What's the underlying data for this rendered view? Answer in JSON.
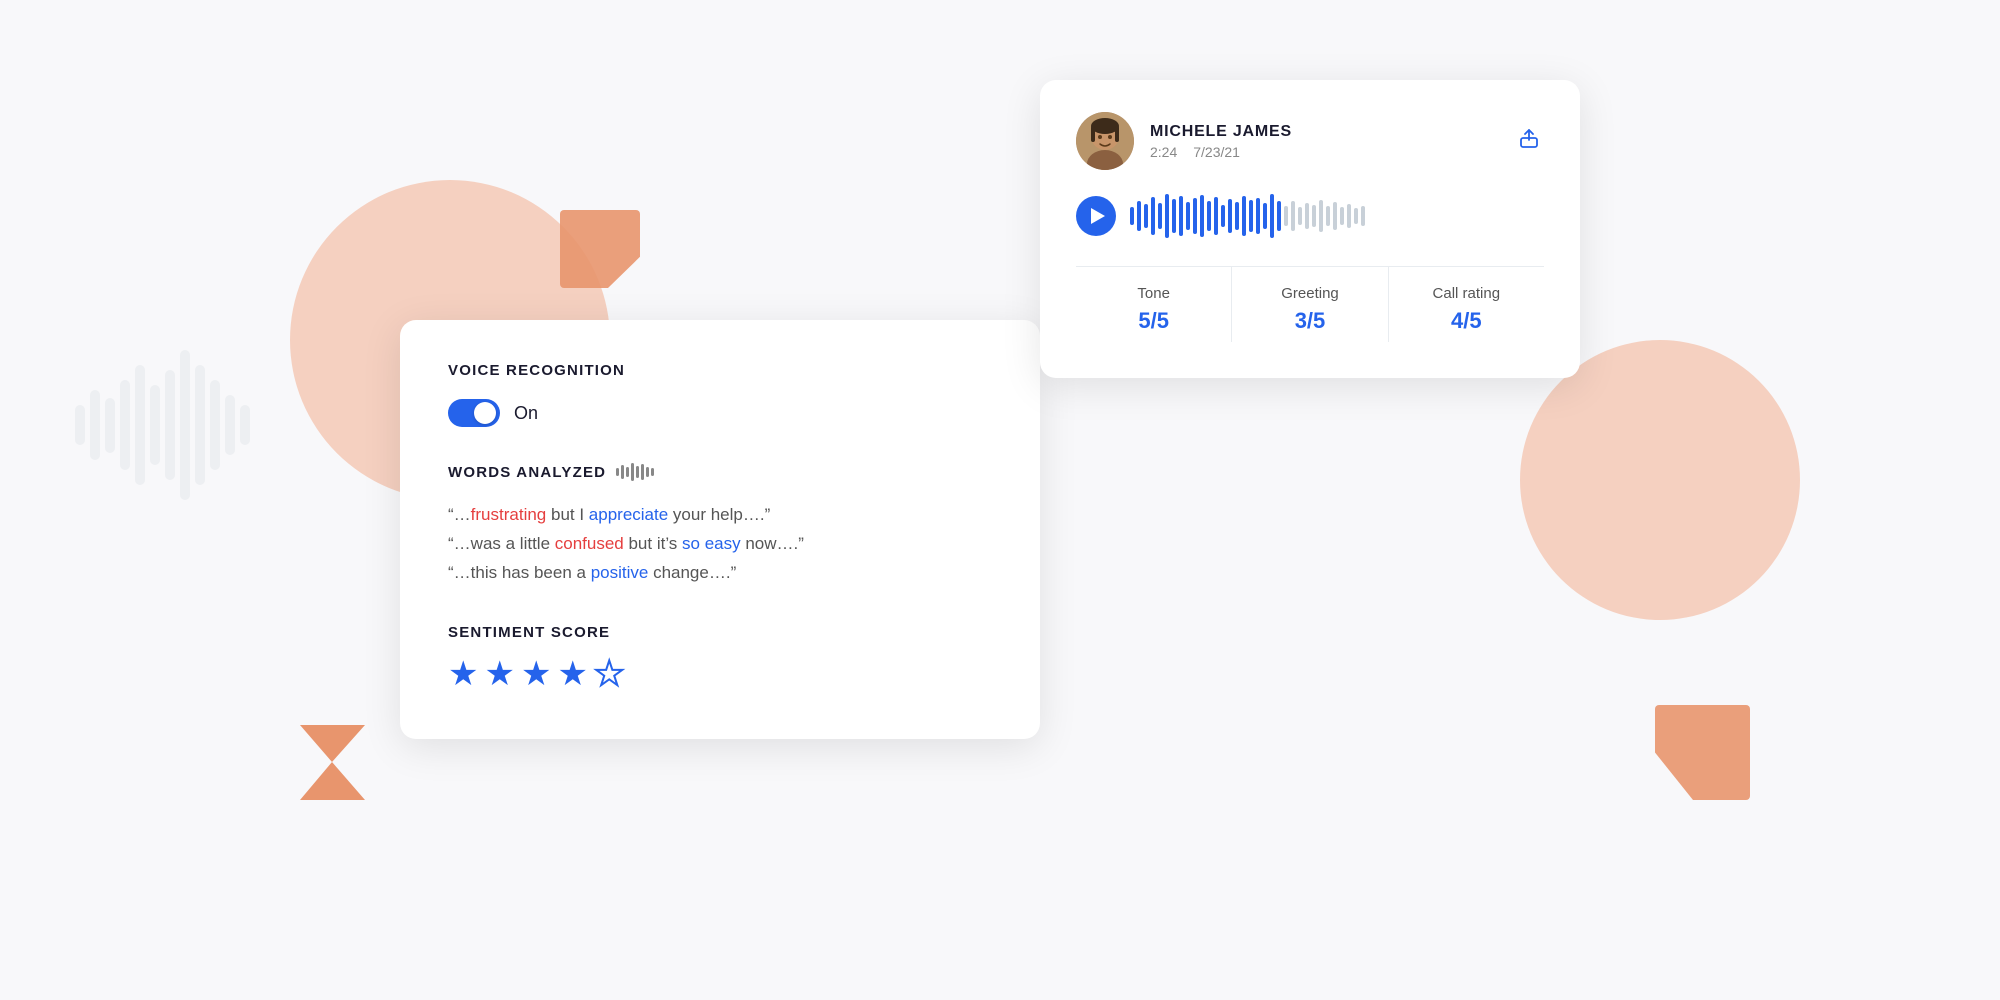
{
  "background": {
    "color": "#f8f8fa"
  },
  "voice_card": {
    "title": "VOICE RECOGNITION",
    "toggle": {
      "state": "on",
      "label": "On"
    },
    "words_analyzed": {
      "title": "WORDS ANALYZED"
    },
    "quotes": [
      {
        "text_before": "“…",
        "word1": "frustrating",
        "word1_class": "negative",
        "text_middle": " but I ",
        "word2": "appreciate",
        "word2_class": "positive",
        "text_after": " your help….”"
      },
      {
        "text_before": "“…was a little ",
        "word1": "confused",
        "word1_class": "negative",
        "text_middle": " but it’s ",
        "word2": "so easy",
        "word2_class": "positive",
        "text_after": " now….”"
      },
      {
        "text_before": "“…this has been a ",
        "word1": "positive",
        "word1_class": "positive",
        "text_middle": " change….”",
        "word2": "",
        "word2_class": "",
        "text_after": ""
      }
    ],
    "sentiment": {
      "title": "SENTIMENT SCORE",
      "stars_filled": 4,
      "stars_total": 5
    }
  },
  "audio_card": {
    "user": {
      "name": "MICHELE JAMES",
      "duration": "2:24",
      "date": "7/23/21"
    },
    "metrics": [
      {
        "label": "Tone",
        "value": "5/5"
      },
      {
        "label": "Greeting",
        "value": "3/5"
      },
      {
        "label": "Call rating",
        "value": "4/5"
      }
    ],
    "share_icon": "↗"
  },
  "waveform": {
    "active_bars": 22,
    "total_bars": 34
  }
}
